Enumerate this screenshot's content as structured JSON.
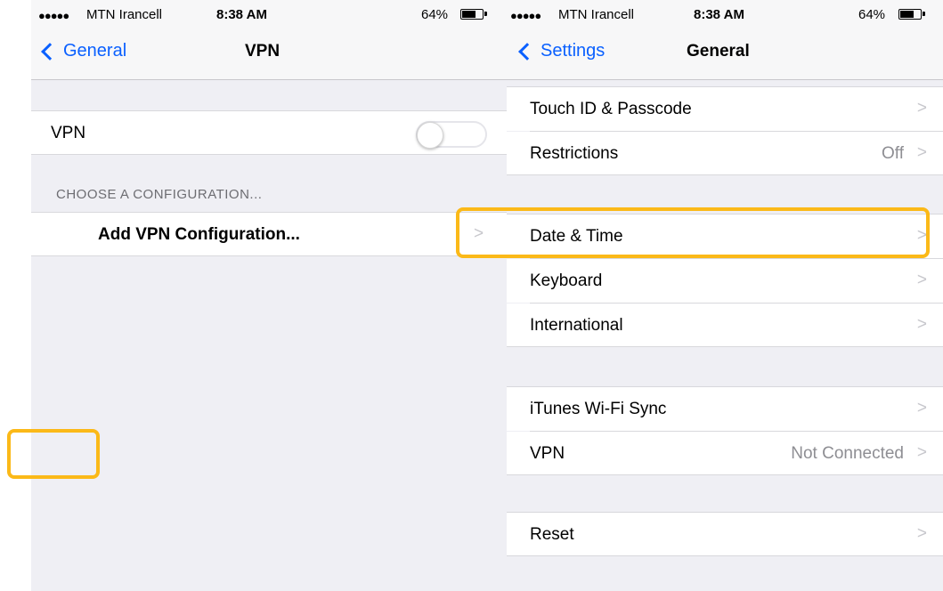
{
  "left": {
    "status": {
      "dots": "●●●●●",
      "carrier": "MTN Irancell",
      "time": "8:38 AM",
      "battery": "64%"
    },
    "nav": {
      "back_label": "General",
      "title": "VPN"
    },
    "vpn_row": {
      "label": "VPN",
      "toggle_on": false
    },
    "section_header": "CHOOSE A CONFIGURATION...",
    "add_row": {
      "label": "Add VPN Configuration...",
      "chevron": ">"
    }
  },
  "right": {
    "status": {
      "dots": "●●●●●",
      "carrier": "MTN Irancell",
      "time": "8:38 AM",
      "battery": "64%"
    },
    "nav": {
      "back_label": "Settings",
      "title": "General"
    },
    "rows": [
      {
        "label": "Touch ID & Passcode",
        "value": "",
        "chevron": ">"
      },
      {
        "label": "Restrictions",
        "value": "Off",
        "chevron": ">"
      },
      {
        "label": "Date & Time",
        "value": "",
        "chevron": ">"
      },
      {
        "label": "Keyboard",
        "value": "",
        "chevron": ">"
      },
      {
        "label": "International",
        "value": "",
        "chevron": ">"
      },
      {
        "label": "iTunes Wi-Fi Sync",
        "value": "",
        "chevron": ">"
      },
      {
        "label": "VPN",
        "value": "Not Connected",
        "chevron": ">"
      },
      {
        "label": "Reset",
        "value": "",
        "chevron": ">"
      }
    ]
  },
  "colors": {
    "accent": "#0a60ff",
    "highlight": "#fbb918",
    "group_bg": "#efeff4"
  }
}
